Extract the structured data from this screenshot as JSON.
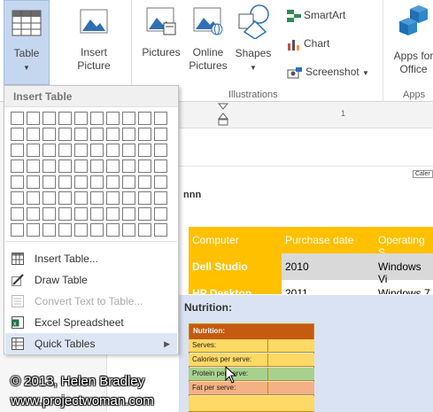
{
  "ribbon": {
    "table_label": "Table",
    "insert_picture_label_1": "Insert",
    "insert_picture_label_2": "Picture",
    "pictures_label": "Pictures",
    "online_pictures_label_1": "Online",
    "online_pictures_label_2": "Pictures",
    "shapes_label": "Shapes",
    "smartart_label": "SmartArt",
    "chart_label": "Chart",
    "screenshot_label": "Screenshot",
    "apps_label_1": "Apps for",
    "apps_label_2": "Office",
    "illustrations_group": "Illustrations",
    "apps_group": "Apps"
  },
  "ruler": {
    "mark": "1"
  },
  "dropdown": {
    "header": "Insert Table",
    "grid_cols": 10,
    "grid_rows": 8,
    "items": [
      {
        "label": "Insert Table...",
        "icon": "insert-table-icon",
        "disabled": false
      },
      {
        "label": "Draw Table",
        "icon": "draw-table-icon",
        "disabled": false
      },
      {
        "label": "Convert Text to Table...",
        "icon": "convert-text-icon",
        "disabled": true
      },
      {
        "label": "Excel Spreadsheet",
        "icon": "excel-icon",
        "disabled": false
      },
      {
        "label": "Quick Tables",
        "icon": "quick-tables-icon",
        "disabled": false,
        "submenu": true
      }
    ]
  },
  "document": {
    "partial_text": "nnn",
    "caler_tab": "Caler",
    "computer_table": {
      "headers": [
        "Computer",
        "Purchase date",
        "Operating S"
      ],
      "rows": [
        [
          "Dell Studio",
          "2010",
          "Windows Vi"
        ],
        [
          "HP Desktop",
          "2011",
          "Windows 7"
        ]
      ]
    },
    "nutrition_heading": "Nutrition:",
    "nutrition_table": {
      "title": "Nutrition:",
      "rows": [
        "Serves:",
        "Calories per serve:",
        "Protein per serve:",
        "Fat per serve:"
      ]
    }
  },
  "watermark": {
    "line1": "© 2013, Helen Bradley",
    "line2": "www.projectwoman.com"
  },
  "colors": {
    "accent_orange": "#ffc000",
    "header_orange": "#c55a11",
    "highlight_blue": "#dce6f4"
  }
}
